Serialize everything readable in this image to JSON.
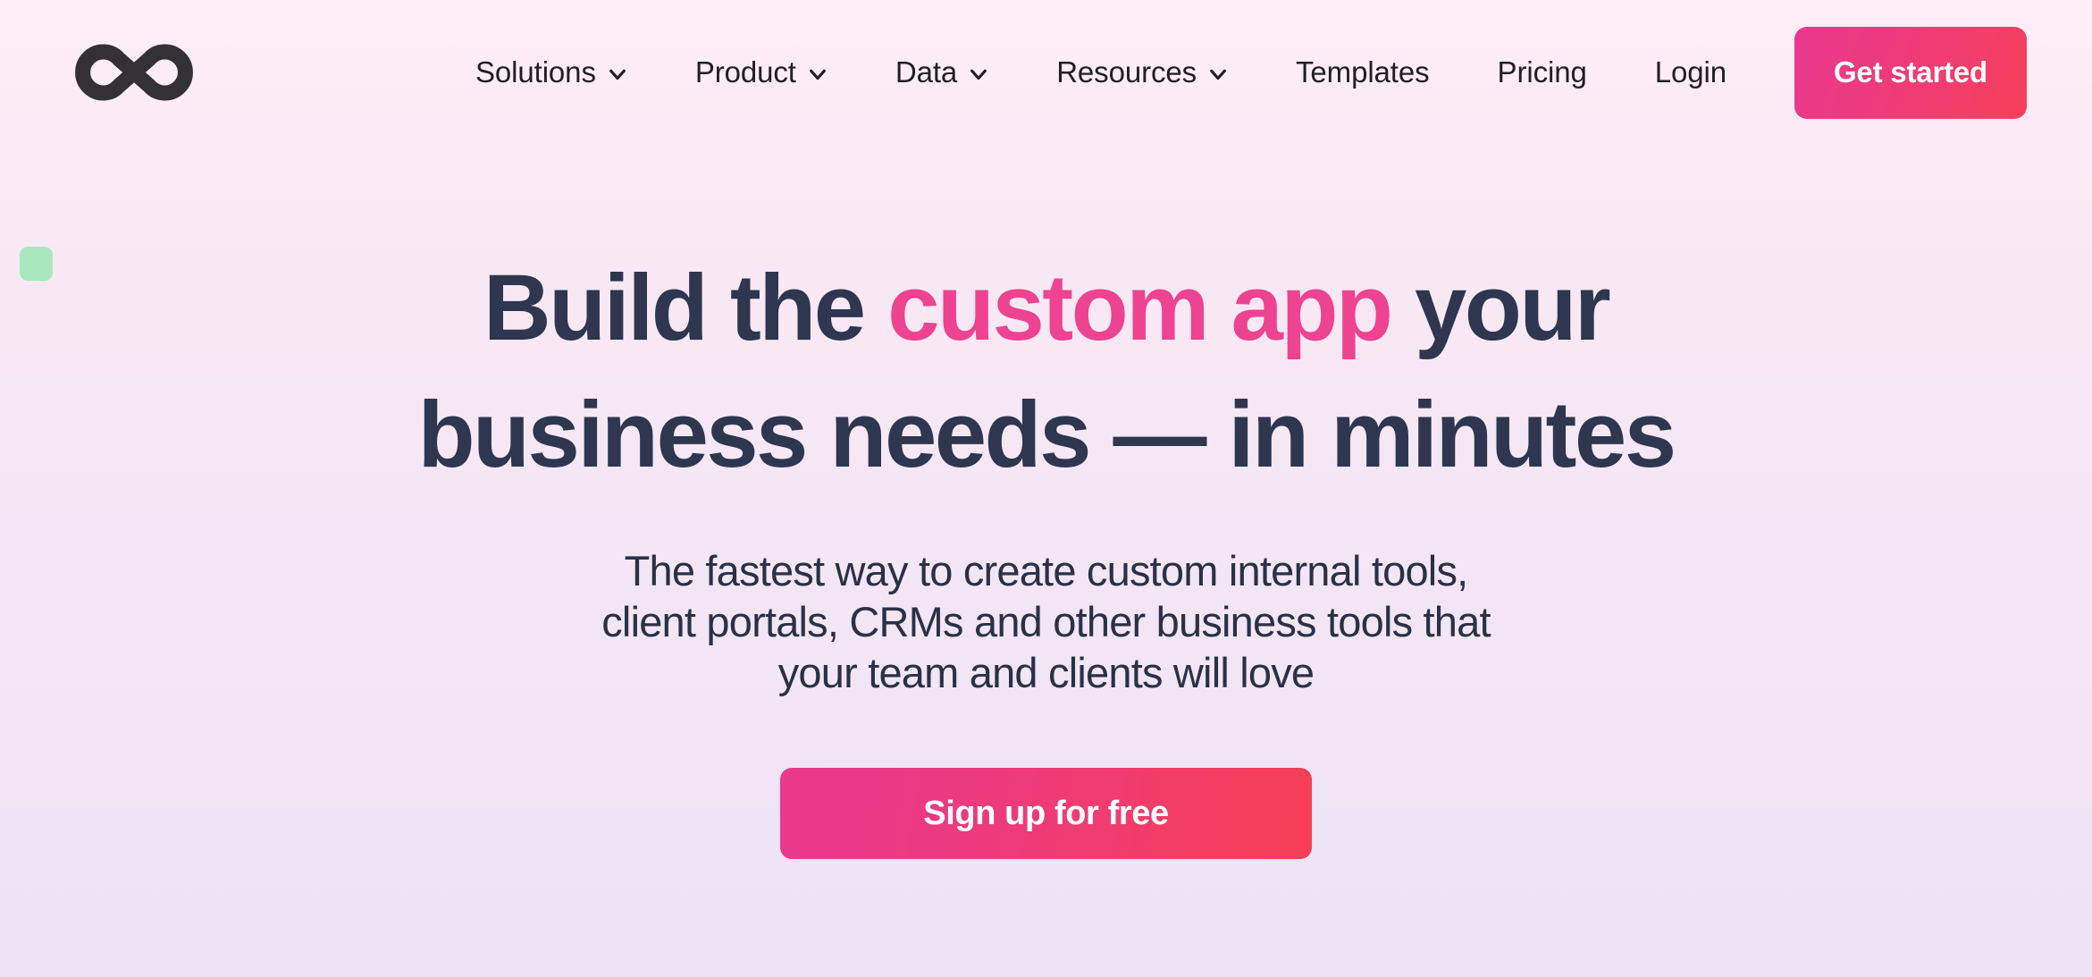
{
  "theme": {
    "background_top": "#FDEEF6",
    "background_bottom": "#EDE3F5",
    "accent_pink": "#EE4391",
    "accent_red": "#F63F54",
    "heading_navy": "#2E3650",
    "decor_green": "#A7E9BC",
    "nav_text": "#221F24"
  },
  "header": {
    "logo_name": "infinity-loop-logo",
    "nav": [
      {
        "label": "Solutions",
        "has_dropdown": true
      },
      {
        "label": "Product",
        "has_dropdown": true
      },
      {
        "label": "Data",
        "has_dropdown": true
      },
      {
        "label": "Resources",
        "has_dropdown": true
      },
      {
        "label": "Templates",
        "has_dropdown": false
      },
      {
        "label": "Pricing",
        "has_dropdown": false
      },
      {
        "label": "Login",
        "has_dropdown": false
      }
    ],
    "cta_label": "Get started"
  },
  "hero": {
    "title": {
      "line1_before": "Build the ",
      "line1_accent": "custom app",
      "line1_after": " your",
      "line2": "business needs — in minutes"
    },
    "subtitle_lines": [
      "The fastest way to create custom internal tools,",
      "client portals, CRMs and other business tools that",
      "your team and clients will love"
    ],
    "cta_label": "Sign up for free"
  },
  "decoration": {
    "square_name": "green-square-decoration"
  }
}
